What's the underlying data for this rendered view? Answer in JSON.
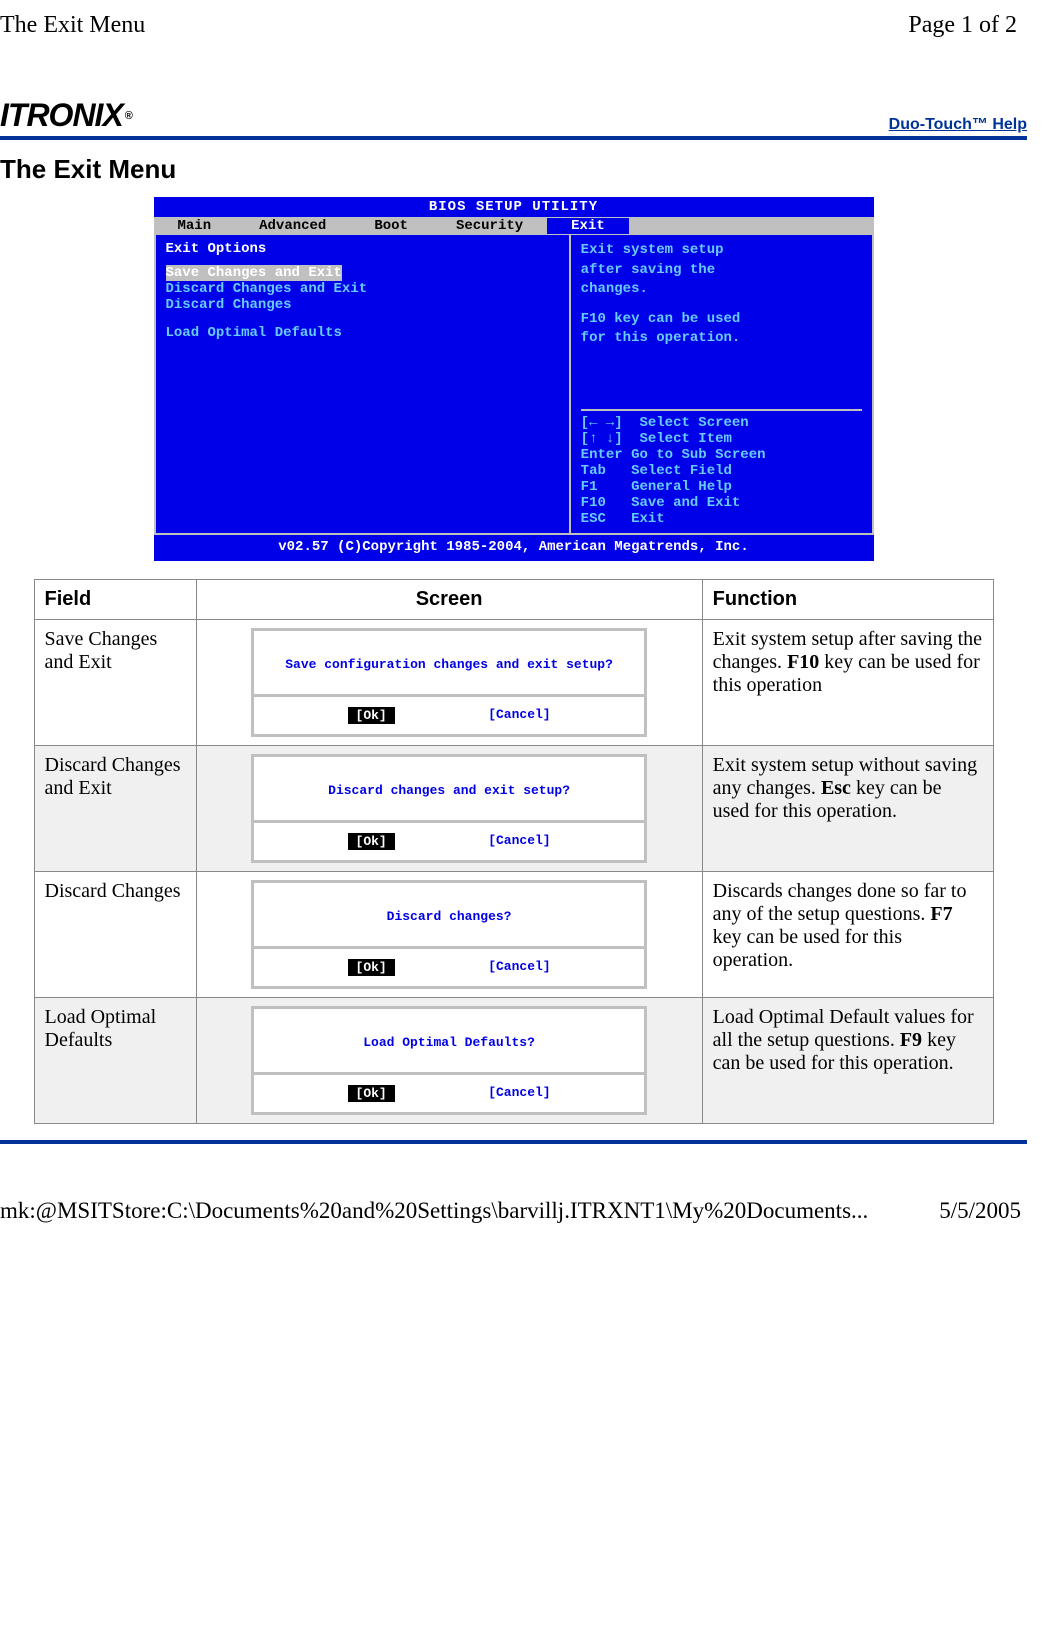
{
  "topbar": {
    "title": "The Exit Menu",
    "pager": "Page 1 of 2"
  },
  "header": {
    "logo": "ITRONIX",
    "logo_reg": "®",
    "help_link": "Duo-Touch™ Help"
  },
  "page_title": "The Exit Menu",
  "bios": {
    "title": "BIOS SETUP UTILITY",
    "tabs": {
      "main": "Main",
      "advanced": "Advanced",
      "boot": "Boot",
      "security": "Security",
      "exit": "Exit"
    },
    "left": {
      "heading": "Exit Options",
      "items": {
        "save_exit": "Save Changes and Exit",
        "discard_exit": "Discard Changes and Exit",
        "discard": "Discard Changes",
        "load_defaults": "Load Optimal Defaults"
      }
    },
    "right_top": {
      "l1": "Exit system setup",
      "l2": "after saving the",
      "l3": "changes.",
      "l4": "F10 key can be used",
      "l5": "for this operation."
    },
    "right_bottom": {
      "l1": "[← →]  Select Screen",
      "l2": "[↑ ↓]  Select Item",
      "l3": "Enter Go to Sub Screen",
      "l4": "Tab   Select Field",
      "l5": "F1    General Help",
      "l6": "F10   Save and Exit",
      "l7": "ESC   Exit"
    },
    "footer": "v02.57 (C)Copyright 1985-2004, American Megatrends, Inc."
  },
  "table": {
    "headers": {
      "field": "Field",
      "screen": "Screen",
      "function": "Function"
    },
    "buttons": {
      "ok": "[Ok]",
      "cancel": "[Cancel]"
    },
    "rows": {
      "r1": {
        "field": "Save Changes and Exit",
        "dialog": "Save configuration changes and exit setup?",
        "func_pre": "Exit system setup after saving the changes. ",
        "func_bold": "F10",
        "func_post": " key can be used for this operation"
      },
      "r2": {
        "field": "Discard Changes and Exit",
        "dialog": "Discard changes and exit setup?",
        "func_pre": "Exit system setup without saving any changes. ",
        "func_bold": "Esc",
        "func_post": " key can be used for this operation."
      },
      "r3": {
        "field": "Discard Changes",
        "dialog": "Discard changes?",
        "func_pre": "Discards changes done so far to any of the setup questions. ",
        "func_bold": "F7",
        "func_post": " key can be used for this operation."
      },
      "r4": {
        "field": "Load Optimal Defaults",
        "dialog": "Load Optimal Defaults?",
        "func_pre": "Load Optimal Default values for all the setup questions. ",
        "func_bold": "F9",
        "func_post": " key can be used for this operation."
      }
    }
  },
  "footerbar": {
    "path": "mk:@MSITStore:C:\\Documents%20and%20Settings\\barvillj.ITRXNT1\\My%20Documents...",
    "date": "5/5/2005"
  }
}
